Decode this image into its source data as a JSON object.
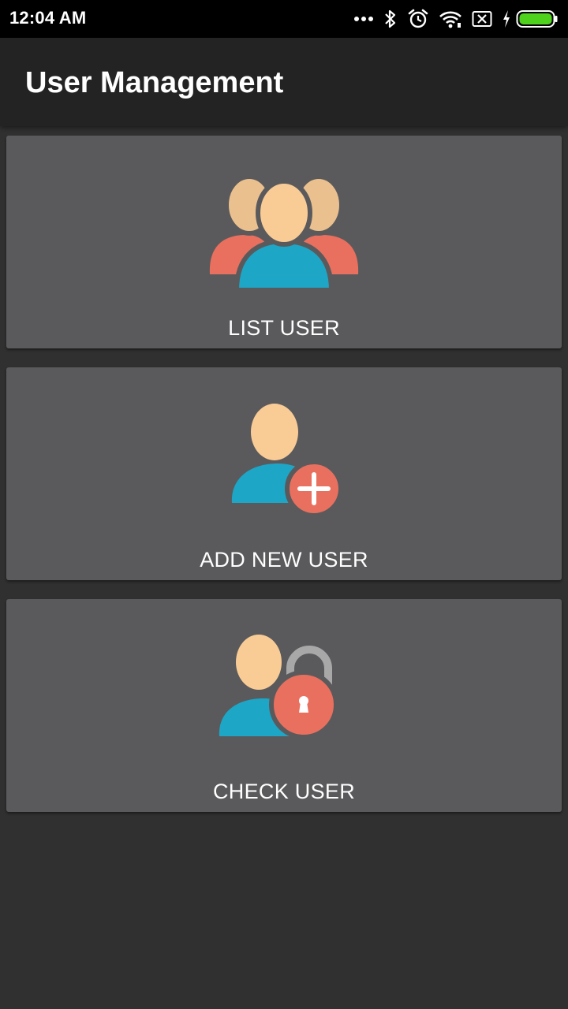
{
  "status_bar": {
    "time": "12:04 AM",
    "icons": [
      "more-dots-icon",
      "bluetooth-icon",
      "alarm-icon",
      "wifi-icon",
      "sim-off-icon",
      "charging-icon",
      "battery-icon"
    ]
  },
  "app_bar": {
    "title": "User Management"
  },
  "menu": {
    "items": [
      {
        "label": "LIST USER",
        "icon": "users-group-icon"
      },
      {
        "label": "ADD NEW USER",
        "icon": "add-user-icon"
      },
      {
        "label": "CHECK USER",
        "icon": "user-lock-icon"
      }
    ]
  },
  "colors": {
    "card_background": "#5a5a5c",
    "app_bar": "#232323",
    "page_background": "#303030",
    "skin": "#f9cc96",
    "skin_back": "#ebc08f",
    "body_blue": "#1ea6c6",
    "accent_red": "#e9705e",
    "battery_green": "#4ed21c"
  }
}
